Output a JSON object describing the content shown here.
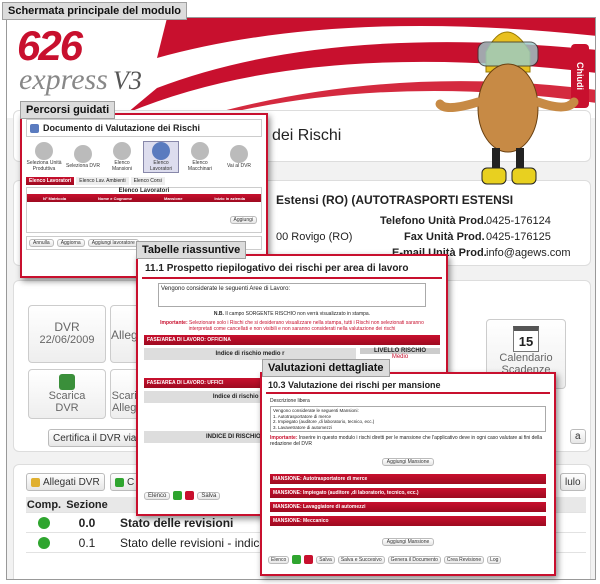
{
  "screen_title": "Schermata principale del modulo",
  "brand": {
    "logo_top": "626",
    "logo_bottom": "express",
    "version": "V3",
    "side_tab": "Chiudi"
  },
  "main": {
    "title_partial": "dei Rischi",
    "company": "Estensi (RO) (AUTOTRASPORTI ESTENSI",
    "address": "00 Rovigo (RO)",
    "phone_label": "Telefono Unità Prod.",
    "phone": "0425-176124",
    "fax_label": "Fax Unità Prod.",
    "fax": "0425-176125",
    "email_label": "E-mail Unità Prod.",
    "email": "info@agews.com",
    "dvr_card": {
      "title": "DVR",
      "date": "22/06/2009"
    },
    "allegati_card": "Allegati",
    "scarica_dvr": {
      "l1": "Scarica",
      "l2": "DVR"
    },
    "scarica_all": {
      "l1": "Scarica",
      "l2": "Allegati"
    },
    "certifica": "Certifica il DVR via M",
    "calendar": {
      "day": "15",
      "l1": "Calendario",
      "l2": "Scadenze"
    },
    "right_btn": "a",
    "allegati_btn": "Allegati DVR",
    "c_btn": "C",
    "modulo_btn": "lulo",
    "table": {
      "headers": [
        "Comp.",
        "Sezione"
      ],
      "rows": [
        {
          "sez": "0.0",
          "desc": "Stato delle revisioni",
          "bold": true
        },
        {
          "sez": "0.1",
          "desc": "Stato delle revisioni - indice",
          "bold": false
        }
      ]
    }
  },
  "guided": {
    "label": "Percorsi guidati",
    "doc_title": "Documento di Valutazione dei Rischi",
    "steps": [
      "Seleziona Unità Produttiva",
      "Seleziona DVR",
      "Elenco Mansioni",
      "Elenco Lavoratori",
      "Elenco Macchinari",
      "Vai al DVR"
    ],
    "tabs": [
      "Elenco Lavoratori",
      "Elenco Lav. Ambienti",
      "Elenco Corsi"
    ],
    "list_title": "Elenco Lavoratori",
    "cols": [
      "N° Matricola",
      "Nome e Cognome",
      "Mansione",
      "Inizio in azienda"
    ],
    "add_btn": "Aggiungi",
    "bottom": [
      "Annulla",
      "Aggiorna",
      "Aggiungi lavoratore"
    ]
  },
  "summary": {
    "label": "Tabelle riassuntive",
    "title": "11.1 Prospetto riepilogativo dei rischi per area di lavoro",
    "textarea": "Vengono considerate le seguenti Aree di Lavoro:",
    "nb_label": "N.B.",
    "nb_text": "Il campo SORGENTE RISCHIO non verrà visualizzato in stampa.",
    "imp_label": "Importante:",
    "imp_text": "Selezionare solo i Rischi che si desiderano visualizzare nella stampa, tutti i Rischi non selezionati saranno interpretati come cancellati e non visibili e non saranno considerati nella valutazione dei rischi",
    "area1": "FASE/AREA DI LAVORO: OFFICINA",
    "area2": "FASE/AREA DI LAVORO: UFFICI",
    "indice": "Indice di rischio medio r",
    "indice2": "Indice di rischio medio re",
    "indice3": "INDICE DI RISCHIO MEDIO RE",
    "livello": "LIVELLO RISCHIO",
    "medio": "Medio",
    "tools": [
      "Elenco",
      "Salva"
    ]
  },
  "detail": {
    "label": "Valutazioni dettagliate",
    "title": "10.3 Valutazione dei rischi per mansione",
    "desc_label": "Descrizione libera",
    "desc_lines": [
      "Vengono considerate le seguenti Mansioni:",
      "1. Autotrasportatore di merce",
      "2. Impiegato (auditore ,di laboratorio, tecnico, ecc.)",
      "3. Lavavetratore di automezzi"
    ],
    "imp_label": "Importante:",
    "imp_text": "Inserire in questo modulo i rischi diretti per le mansione che l'applicativo deve in ogni caso valutare ai fini della redazione del DVR",
    "add_btn": "Aggiungi Mansione",
    "mansioni": [
      "MANSIONE: Autotrasportatore di merce",
      "MANSIONE: Impiegato (auditore ,di laboratorio, tecnico, ecc.)",
      "MANSIONE: Lavaggiatore di automezzi",
      "MANSIONE: Meccanico"
    ],
    "tools": [
      "Elenco",
      "Salva",
      "Salva e Succesivo",
      "Genera il Documento",
      "Crea Revisione",
      "Log"
    ]
  },
  "colors": {
    "accent": "#c8102e",
    "tag_bg": "#dcdcdc",
    "ok_green": "#2fa52f"
  }
}
